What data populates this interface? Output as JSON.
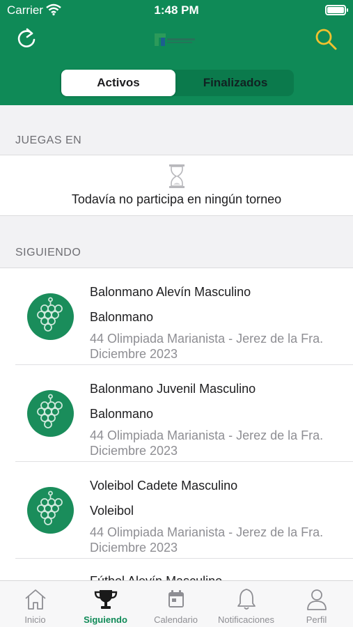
{
  "status_bar": {
    "carrier": "Carrier",
    "time": "1:48 PM"
  },
  "nav": {
    "refresh_icon": "refresh-icon",
    "search_icon": "search-icon"
  },
  "segments": {
    "active": "Activos",
    "inactive": "Finalizados"
  },
  "playing_section": {
    "header": "JUEGAS EN",
    "empty_message": "Todavía no participa en ningún torneo"
  },
  "following_section": {
    "header": "SIGUIENDO",
    "items": [
      {
        "title": "Balonmano Alevín Masculino",
        "sport": "Balonmano",
        "tournament": "44 Olimpiada Marianista - Jerez de la Fra. Diciembre 2023"
      },
      {
        "title": "Balonmano Juvenil Masculino",
        "sport": "Balonmano",
        "tournament": "44 Olimpiada Marianista - Jerez de la Fra. Diciembre 2023"
      },
      {
        "title": "Voleibol Cadete Masculino",
        "sport": "Voleibol",
        "tournament": "44 Olimpiada Marianista - Jerez de la Fra. Diciembre 2023"
      },
      {
        "title": "Fútbol Alevín Masculino",
        "sport": "",
        "tournament": ""
      }
    ]
  },
  "tabbar": {
    "tabs": [
      {
        "label": "Inicio",
        "icon": "home-icon"
      },
      {
        "label": "Siguiendo",
        "icon": "trophy-icon"
      },
      {
        "label": "Calendario",
        "icon": "calendar-icon"
      },
      {
        "label": "Notificaciones",
        "icon": "bell-icon"
      },
      {
        "label": "Perfil",
        "icon": "user-icon"
      }
    ],
    "active_index": 1
  },
  "colors": {
    "brand_green": "#0f8a57",
    "search_yellow": "#f2c12e"
  }
}
